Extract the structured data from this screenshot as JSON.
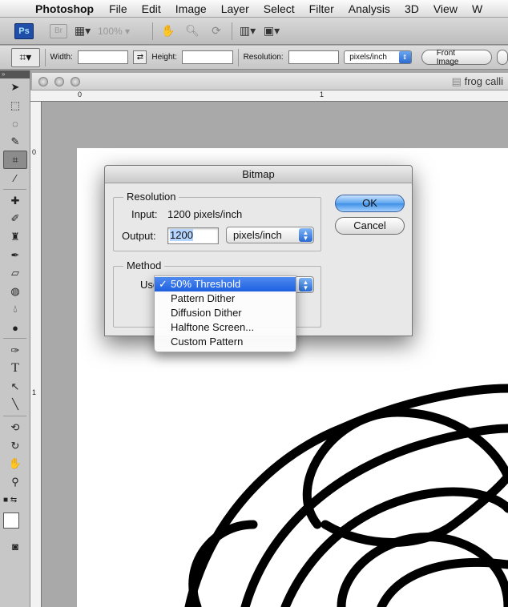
{
  "menubar": {
    "app": "Photoshop",
    "items": [
      "File",
      "Edit",
      "Image",
      "Layer",
      "Select",
      "Filter",
      "Analysis",
      "3D",
      "View",
      "W"
    ]
  },
  "appbar": {
    "ps_badge": "Ps",
    "br_badge": "Br",
    "zoom": "100%"
  },
  "optionsbar": {
    "width_label": "Width:",
    "height_label": "Height:",
    "resolution_label": "Resolution:",
    "unit": "pixels/inch",
    "front_image": "Front Image"
  },
  "document": {
    "title": "frog calli",
    "ruler_h": [
      "0",
      "1"
    ],
    "ruler_v": [
      "0",
      "1"
    ]
  },
  "dialog": {
    "title": "Bitmap",
    "resolution_group": "Resolution",
    "input_label": "Input:",
    "input_value": "1200 pixels/inch",
    "output_label": "Output:",
    "output_value": "1200",
    "output_unit": "pixels/inch",
    "method_group": "Method",
    "use_label": "Use:",
    "ok": "OK",
    "cancel": "Cancel"
  },
  "method_menu": {
    "check": "✓",
    "items": [
      "50% Threshold",
      "Pattern Dither",
      "Diffusion Dither",
      "Halftone Screen...",
      "Custom Pattern"
    ],
    "selected_index": 0
  },
  "colors": {
    "accent": "#3e8fe5",
    "menu_highlight": "#1d5fe0"
  }
}
